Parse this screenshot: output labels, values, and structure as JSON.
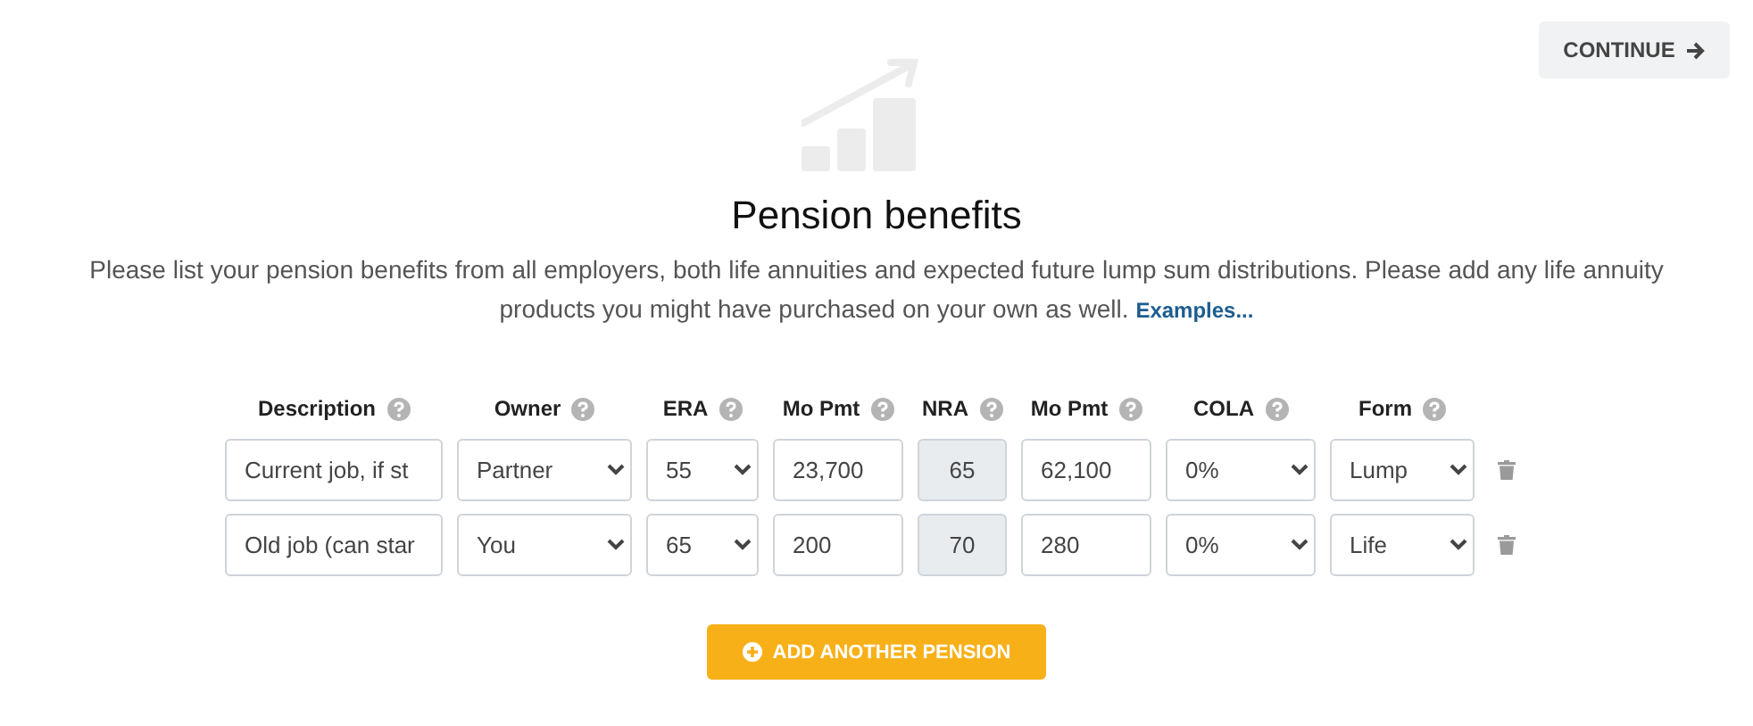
{
  "continue_button": {
    "label": "CONTINUE"
  },
  "title": "Pension benefits",
  "intro": "Please list your pension benefits from all employers, both life annuities and expected future lump sum distributions. Please add any life annuity products you might have purchased on your own as well.",
  "examples_link": "Examples...",
  "columns": [
    {
      "label": "Description",
      "kind": "text"
    },
    {
      "label": "Owner",
      "kind": "select"
    },
    {
      "label": "ERA",
      "kind": "select"
    },
    {
      "label": "Mo Pmt",
      "kind": "amount"
    },
    {
      "label": "NRA",
      "kind": "readonly"
    },
    {
      "label": "Mo Pmt",
      "kind": "amount"
    },
    {
      "label": "COLA",
      "kind": "select"
    },
    {
      "label": "Form",
      "kind": "select"
    }
  ],
  "rows": [
    {
      "cells": [
        "Current job, if st",
        "Partner",
        "55",
        "23,700",
        "65",
        "62,100",
        "0%",
        "Lump"
      ]
    },
    {
      "cells": [
        "Old job (can star",
        "You",
        "65",
        "200",
        "70",
        "280",
        "0%",
        "Life"
      ]
    }
  ],
  "add_button": {
    "label": "ADD ANOTHER PENSION"
  }
}
